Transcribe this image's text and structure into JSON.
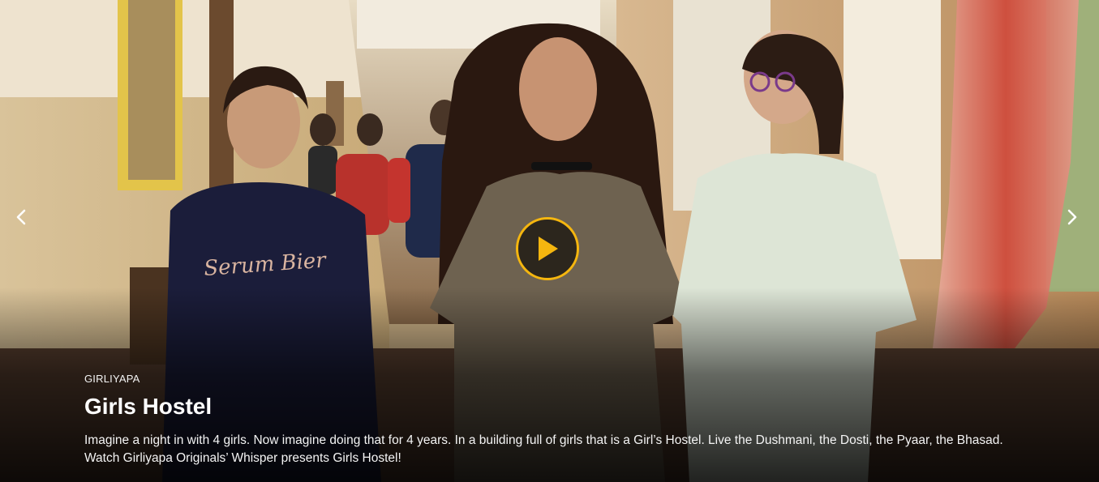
{
  "hero": {
    "channel": "GIRLIYAPA",
    "title": "Girls Hostel",
    "description": "Imagine a night in with 4 girls. Now imagine doing that for 4 years. In a building full of girls that is a Girl’s Hostel. Live the Dushmani, the Dosti, the Pyaar, the Bhasad. Watch Girliyapa Originals’ Whisper presents Girls Hostel!",
    "shirt_text": "Serum Bier"
  },
  "controls": {
    "prev_icon": "chevron-left-icon",
    "next_icon": "chevron-right-icon",
    "play_icon": "play-icon"
  },
  "colors": {
    "accent": "#f5b60f",
    "text": "#ffffff"
  }
}
